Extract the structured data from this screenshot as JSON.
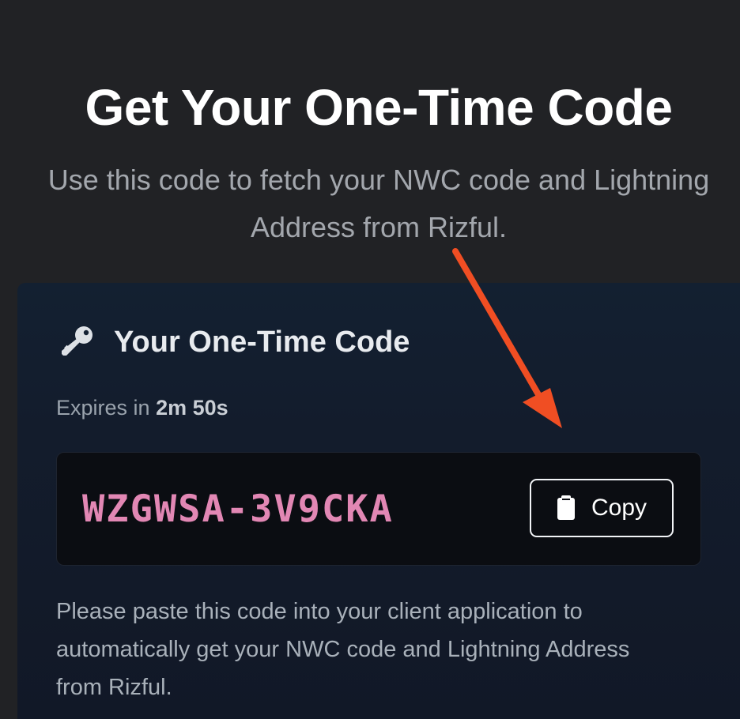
{
  "header": {
    "title": "Get Your One-Time Code",
    "subtitle_line1": "Use this code to fetch your NWC code and Lightning",
    "subtitle_line2": "Address from Rizful."
  },
  "card": {
    "icon": "key-icon",
    "title": "Your One-Time Code",
    "expires_prefix": "Expires in",
    "expires_time": "2m 50s",
    "code": "WZGWSA-3V9CKA",
    "copy_icon": "clipboard-icon",
    "copy_label": "Copy",
    "instructions_line1": "Please paste this code into your client application to",
    "instructions_line2": "automatically get your NWC code and Lightning Address",
    "instructions_line3": "from Rizful."
  },
  "annotation": {
    "arrow_color": "#f04e23"
  },
  "colors": {
    "background": "#212225",
    "card": "#121a29",
    "code_text": "#e287b4"
  }
}
